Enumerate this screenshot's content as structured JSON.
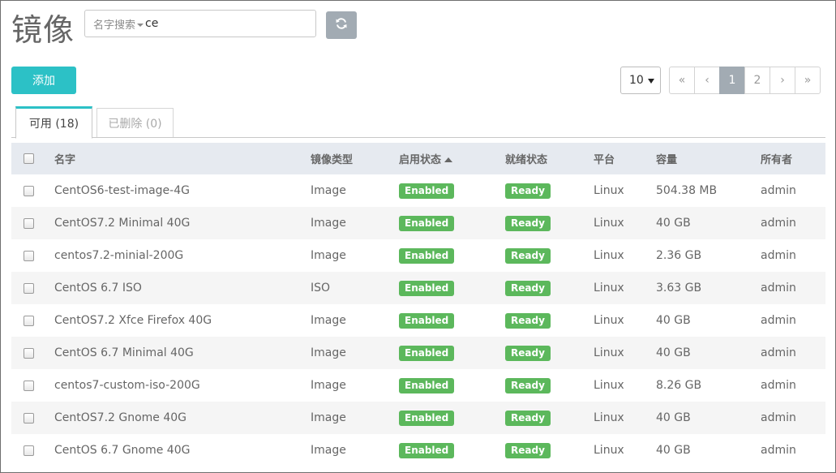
{
  "page_title": "镜像",
  "search": {
    "label": "名字搜索",
    "value": "ce"
  },
  "toolbar": {
    "add_label": "添加"
  },
  "pagination": {
    "page_size": "10",
    "buttons": [
      "«",
      "‹",
      "1",
      "2",
      "›",
      "»"
    ],
    "active_page": "1"
  },
  "tabs": [
    {
      "label": "可用 (18)",
      "active": true
    },
    {
      "label": "已删除 (0)",
      "active": false
    }
  ],
  "table": {
    "headers": [
      "名字",
      "镜像类型",
      "启用状态",
      "就绪状态",
      "平台",
      "容量",
      "所有者"
    ],
    "sorted_column": "启用状态",
    "rows": [
      [
        "CentOS6-test-image-4G",
        "Image",
        "Enabled",
        "Ready",
        "Linux",
        "504.38 MB",
        "admin"
      ],
      [
        "CentOS7.2 Minimal 40G",
        "Image",
        "Enabled",
        "Ready",
        "Linux",
        "40 GB",
        "admin"
      ],
      [
        "centos7.2-minial-200G",
        "Image",
        "Enabled",
        "Ready",
        "Linux",
        "2.36 GB",
        "admin"
      ],
      [
        "CentOS 6.7 ISO",
        "ISO",
        "Enabled",
        "Ready",
        "Linux",
        "3.63 GB",
        "admin"
      ],
      [
        "CentOS7.2 Xfce Firefox 40G",
        "Image",
        "Enabled",
        "Ready",
        "Linux",
        "40 GB",
        "admin"
      ],
      [
        "CentOS 6.7 Minimal 40G",
        "Image",
        "Enabled",
        "Ready",
        "Linux",
        "40 GB",
        "admin"
      ],
      [
        "centos7-custom-iso-200G",
        "Image",
        "Enabled",
        "Ready",
        "Linux",
        "8.26 GB",
        "admin"
      ],
      [
        "CentOS7.2 Gnome 40G",
        "Image",
        "Enabled",
        "Ready",
        "Linux",
        "40 GB",
        "admin"
      ],
      [
        "CentOS 6.7 Gnome 40G",
        "Image",
        "Enabled",
        "Ready",
        "Linux",
        "40 GB",
        "admin"
      ]
    ]
  },
  "colors": {
    "accent": "#2cc1c6",
    "badge_green": "#5cb85c",
    "active_page": "#a2abb3",
    "header_bg": "#e6eaf0"
  },
  "icons": {
    "refresh": "refresh-icon",
    "sort": "sort-ascending-icon"
  }
}
